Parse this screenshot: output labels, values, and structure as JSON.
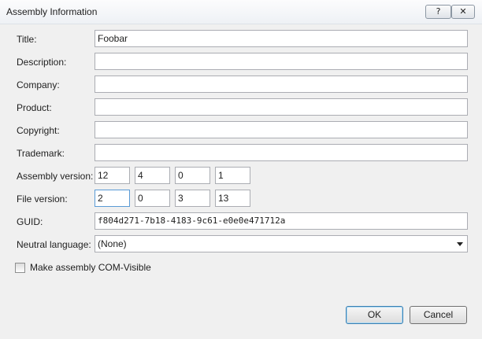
{
  "window": {
    "title": "Assembly Information",
    "help_glyph": "?",
    "close_glyph": "✕"
  },
  "labels": {
    "title": "Title:",
    "description": "Description:",
    "company": "Company:",
    "product": "Product:",
    "copyright": "Copyright:",
    "trademark": "Trademark:",
    "assembly_version": "Assembly version:",
    "file_version": "File version:",
    "guid": "GUID:",
    "neutral_language": "Neutral language:",
    "com_visible": "Make assembly COM-Visible"
  },
  "fields": {
    "title": "Foobar",
    "description": "",
    "company": "",
    "product": "",
    "copyright": "",
    "trademark": "",
    "assembly_version": [
      "12",
      "4",
      "0",
      "1"
    ],
    "file_version": [
      "2",
      "0",
      "3",
      "13"
    ],
    "guid": "f804d271-7b18-4183-9c61-e0e0e471712a",
    "neutral_language": "(None)",
    "com_visible_checked": false
  },
  "buttons": {
    "ok": "OK",
    "cancel": "Cancel"
  }
}
